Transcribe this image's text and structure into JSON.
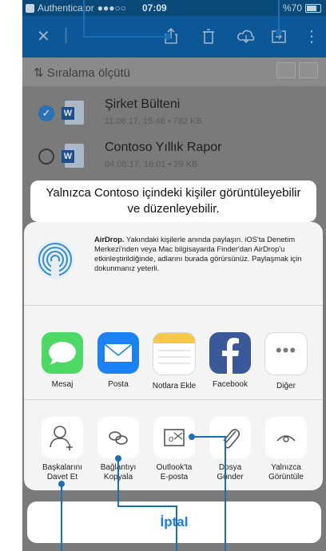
{
  "status_bar": {
    "carrier": "Authenticator",
    "signal": "●●●○○",
    "time": "07:09",
    "battery": "%70"
  },
  "toolbar": {
    "close_icon": "close-icon",
    "share_icon": "share-icon",
    "delete_icon": "trash-icon",
    "cloud_icon": "cloud-icon",
    "move_icon": "move-icon",
    "more_icon": "more-vertical-icon"
  },
  "list": {
    "sort_label": "Sıralama ölçütü",
    "files": [
      {
        "name": "Şirket Bülteni",
        "meta": "11.08.17, 15:48 • 782 KB",
        "selected": true
      },
      {
        "name": "Contoso Yıllık Rapor",
        "meta": "04.08.17, 16:01 • 29 KB",
        "selected": false
      }
    ]
  },
  "banner": {
    "line1": "Yalnızca Contoso içindeki kişiler görüntüleyebilir",
    "line2": "ve düzenleyebilir."
  },
  "airdrop": {
    "title": "AirDrop.",
    "description": " Yakındaki kişilerle anında paylaşın. iOS'ta Denetim Merkezi'nden veya Mac bilgisayarda Finder'dan AirDrop'u etkinleştirildiğinde, adlarını burada görürsünüz. Paylaşmak için dokunmanız yeterli."
  },
  "apps": [
    {
      "label": "Mesaj",
      "icon": "messages-icon"
    },
    {
      "label": "Posta",
      "icon": "mail-icon"
    },
    {
      "label": "Notlara Ekle",
      "icon": "notes-icon"
    },
    {
      "label": "Facebook",
      "icon": "facebook-icon"
    },
    {
      "label": "Diğer",
      "icon": "more-icon"
    }
  ],
  "actions": [
    {
      "line1": "Başkalarını",
      "line2": "Davet Et",
      "icon": "add-person-icon"
    },
    {
      "line1": "Bağlantıyı",
      "line2": "Kopyala",
      "icon": "link-icon"
    },
    {
      "line1": "Outlook'ta",
      "line2": "E-posta",
      "icon": "outlook-icon"
    },
    {
      "line1": "Dosya",
      "line2": "Gönder",
      "icon": "paperclip-icon"
    },
    {
      "line1": "Yalnızca",
      "line2": "Görüntüle",
      "icon": "eye-icon"
    }
  ],
  "cancel_label": "İptal",
  "colors": {
    "toolbar": "#0b5798",
    "accent": "#1b7cf0",
    "callout": "#1b6fb5"
  }
}
